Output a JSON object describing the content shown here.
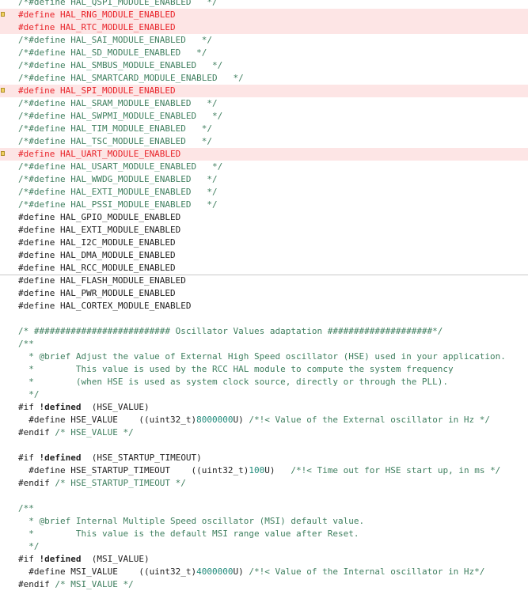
{
  "colors": {
    "comment": "#3f7f5f",
    "inactive_define": "#e8242a",
    "number": "#1e8a7a",
    "text": "#1f1f1f",
    "highlight_bg": "#fde5e5",
    "marker": "#f0d060"
  },
  "editor": {
    "lines": [
      {
        "segments": [
          {
            "c": "c",
            "t": "/*#define HAL_QSPI_MODULE_ENABLED   */"
          }
        ]
      },
      {
        "hl": true,
        "marker": true,
        "segments": [
          {
            "c": "r",
            "t": "#define HAL_RNG_MODULE_ENABLED"
          }
        ]
      },
      {
        "hl": true,
        "segments": [
          {
            "c": "r",
            "t": "#define HAL_RTC_MODULE_ENABLED"
          }
        ]
      },
      {
        "segments": [
          {
            "c": "c",
            "t": "/*#define HAL_SAI_MODULE_ENABLED   */"
          }
        ]
      },
      {
        "segments": [
          {
            "c": "c",
            "t": "/*#define HAL_SD_MODULE_ENABLED   */"
          }
        ]
      },
      {
        "segments": [
          {
            "c": "c",
            "t": "/*#define HAL_SMBUS_MODULE_ENABLED   */"
          }
        ]
      },
      {
        "segments": [
          {
            "c": "c",
            "t": "/*#define HAL_SMARTCARD_MODULE_ENABLED   */"
          }
        ]
      },
      {
        "hl": true,
        "marker": true,
        "segments": [
          {
            "c": "r",
            "t": "#define HAL_SPI_MODULE_ENABLED"
          }
        ]
      },
      {
        "segments": [
          {
            "c": "c",
            "t": "/*#define HAL_SRAM_MODULE_ENABLED   */"
          }
        ]
      },
      {
        "segments": [
          {
            "c": "c",
            "t": "/*#define HAL_SWPMI_MODULE_ENABLED   */"
          }
        ]
      },
      {
        "segments": [
          {
            "c": "c",
            "t": "/*#define HAL_TIM_MODULE_ENABLED   */"
          }
        ]
      },
      {
        "segments": [
          {
            "c": "c",
            "t": "/*#define HAL_TSC_MODULE_ENABLED   */"
          }
        ]
      },
      {
        "hl": true,
        "marker": true,
        "segments": [
          {
            "c": "r",
            "t": "#define HAL_UART_MODULE_ENABLED"
          }
        ]
      },
      {
        "segments": [
          {
            "c": "c",
            "t": "/*#define HAL_USART_MODULE_ENABLED   */"
          }
        ]
      },
      {
        "segments": [
          {
            "c": "c",
            "t": "/*#define HAL_WWDG_MODULE_ENABLED   */"
          }
        ]
      },
      {
        "segments": [
          {
            "c": "c",
            "t": "/*#define HAL_EXTI_MODULE_ENABLED   */"
          }
        ]
      },
      {
        "segments": [
          {
            "c": "c",
            "t": "/*#define HAL_PSSI_MODULE_ENABLED   */"
          }
        ]
      },
      {
        "segments": [
          {
            "c": "t",
            "t": "#define HAL_GPIO_MODULE_ENABLED"
          }
        ]
      },
      {
        "segments": [
          {
            "c": "t",
            "t": "#define HAL_EXTI_MODULE_ENABLED"
          }
        ]
      },
      {
        "segments": [
          {
            "c": "t",
            "t": "#define HAL_I2C_MODULE_ENABLED"
          }
        ]
      },
      {
        "segments": [
          {
            "c": "t",
            "t": "#define HAL_DMA_MODULE_ENABLED"
          }
        ]
      },
      {
        "cursor": true,
        "segments": [
          {
            "c": "t",
            "t": "#define HAL_RCC_MODULE_ENABLED"
          }
        ]
      },
      {
        "segments": [
          {
            "c": "t",
            "t": "#define HAL_FLASH_MODULE_ENABLED"
          }
        ]
      },
      {
        "segments": [
          {
            "c": "t",
            "t": "#define HAL_PWR_MODULE_ENABLED"
          }
        ]
      },
      {
        "segments": [
          {
            "c": "t",
            "t": "#define HAL_CORTEX_MODULE_ENABLED"
          }
        ]
      },
      {
        "segments": [
          {
            "c": "t",
            "t": ""
          }
        ]
      },
      {
        "segments": [
          {
            "c": "c",
            "t": "/* ########################## Oscillator Values adaptation ####################*/"
          }
        ]
      },
      {
        "segments": [
          {
            "c": "c",
            "t": "/**"
          }
        ]
      },
      {
        "segments": [
          {
            "c": "c",
            "t": "  * @brief Adjust the value of External High Speed oscillator (HSE) used in your application."
          }
        ]
      },
      {
        "segments": [
          {
            "c": "c",
            "t": "  *        This value is used by the RCC HAL module to compute the system frequency"
          }
        ]
      },
      {
        "segments": [
          {
            "c": "c",
            "t": "  *        (when HSE is used as system clock source, directly or through the PLL)."
          }
        ]
      },
      {
        "segments": [
          {
            "c": "c",
            "t": "  */"
          }
        ]
      },
      {
        "segments": [
          {
            "c": "t",
            "t": "#if "
          },
          {
            "c": "k",
            "t": "!defined"
          },
          {
            "c": "t",
            "t": "  (HSE_VALUE)"
          }
        ]
      },
      {
        "segments": [
          {
            "c": "t",
            "t": "  #define HSE_VALUE    ((uint32_t)"
          },
          {
            "c": "n",
            "t": "8000000"
          },
          {
            "c": "t",
            "t": "U) "
          },
          {
            "c": "c",
            "t": "/*!< Value of the External oscillator in Hz */"
          }
        ]
      },
      {
        "segments": [
          {
            "c": "t",
            "t": "#endif "
          },
          {
            "c": "c",
            "t": "/* HSE_VALUE */"
          }
        ]
      },
      {
        "segments": [
          {
            "c": "t",
            "t": ""
          }
        ]
      },
      {
        "segments": [
          {
            "c": "t",
            "t": "#if "
          },
          {
            "c": "k",
            "t": "!defined"
          },
          {
            "c": "t",
            "t": "  (HSE_STARTUP_TIMEOUT)"
          }
        ]
      },
      {
        "segments": [
          {
            "c": "t",
            "t": "  #define HSE_STARTUP_TIMEOUT    ((uint32_t)"
          },
          {
            "c": "n",
            "t": "100"
          },
          {
            "c": "t",
            "t": "U)   "
          },
          {
            "c": "c",
            "t": "/*!< Time out for HSE start up, in ms */"
          }
        ]
      },
      {
        "segments": [
          {
            "c": "t",
            "t": "#endif "
          },
          {
            "c": "c",
            "t": "/* HSE_STARTUP_TIMEOUT */"
          }
        ]
      },
      {
        "segments": [
          {
            "c": "t",
            "t": ""
          }
        ]
      },
      {
        "segments": [
          {
            "c": "c",
            "t": "/**"
          }
        ]
      },
      {
        "segments": [
          {
            "c": "c",
            "t": "  * @brief Internal Multiple Speed oscillator (MSI) default value."
          }
        ]
      },
      {
        "segments": [
          {
            "c": "c",
            "t": "  *        This value is the default MSI range value after Reset."
          }
        ]
      },
      {
        "segments": [
          {
            "c": "c",
            "t": "  */"
          }
        ]
      },
      {
        "segments": [
          {
            "c": "t",
            "t": "#if "
          },
          {
            "c": "k",
            "t": "!defined"
          },
          {
            "c": "t",
            "t": "  (MSI_VALUE)"
          }
        ]
      },
      {
        "segments": [
          {
            "c": "t",
            "t": "  #define MSI_VALUE    ((uint32_t)"
          },
          {
            "c": "n",
            "t": "4000000"
          },
          {
            "c": "t",
            "t": "U) "
          },
          {
            "c": "c",
            "t": "/*!< Value of the Internal oscillator in Hz*/"
          }
        ]
      },
      {
        "segments": [
          {
            "c": "t",
            "t": "#endif "
          },
          {
            "c": "c",
            "t": "/* MSI_VALUE */"
          }
        ]
      }
    ]
  }
}
